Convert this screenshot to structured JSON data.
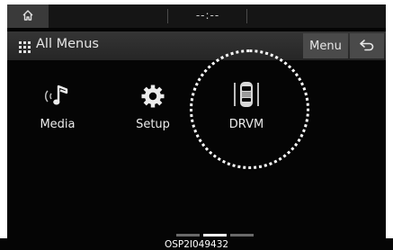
{
  "statusbar": {
    "clock": "--:--"
  },
  "header": {
    "title": "All Menus",
    "menu_label": "Menu"
  },
  "menu_items": [
    {
      "label": "Media",
      "icon": "music-note-icon"
    },
    {
      "label": "Setup",
      "icon": "gear-icon"
    },
    {
      "label": "DRVM",
      "icon": "car-cameras-icon"
    }
  ],
  "pagination": {
    "current_page": 2,
    "total_pages": 3
  },
  "caption": "OSP2I049432",
  "colors": {
    "background": "#050505",
    "bar": "#3a3a3a",
    "text": "#ececec",
    "highlight": "#ffffff"
  }
}
